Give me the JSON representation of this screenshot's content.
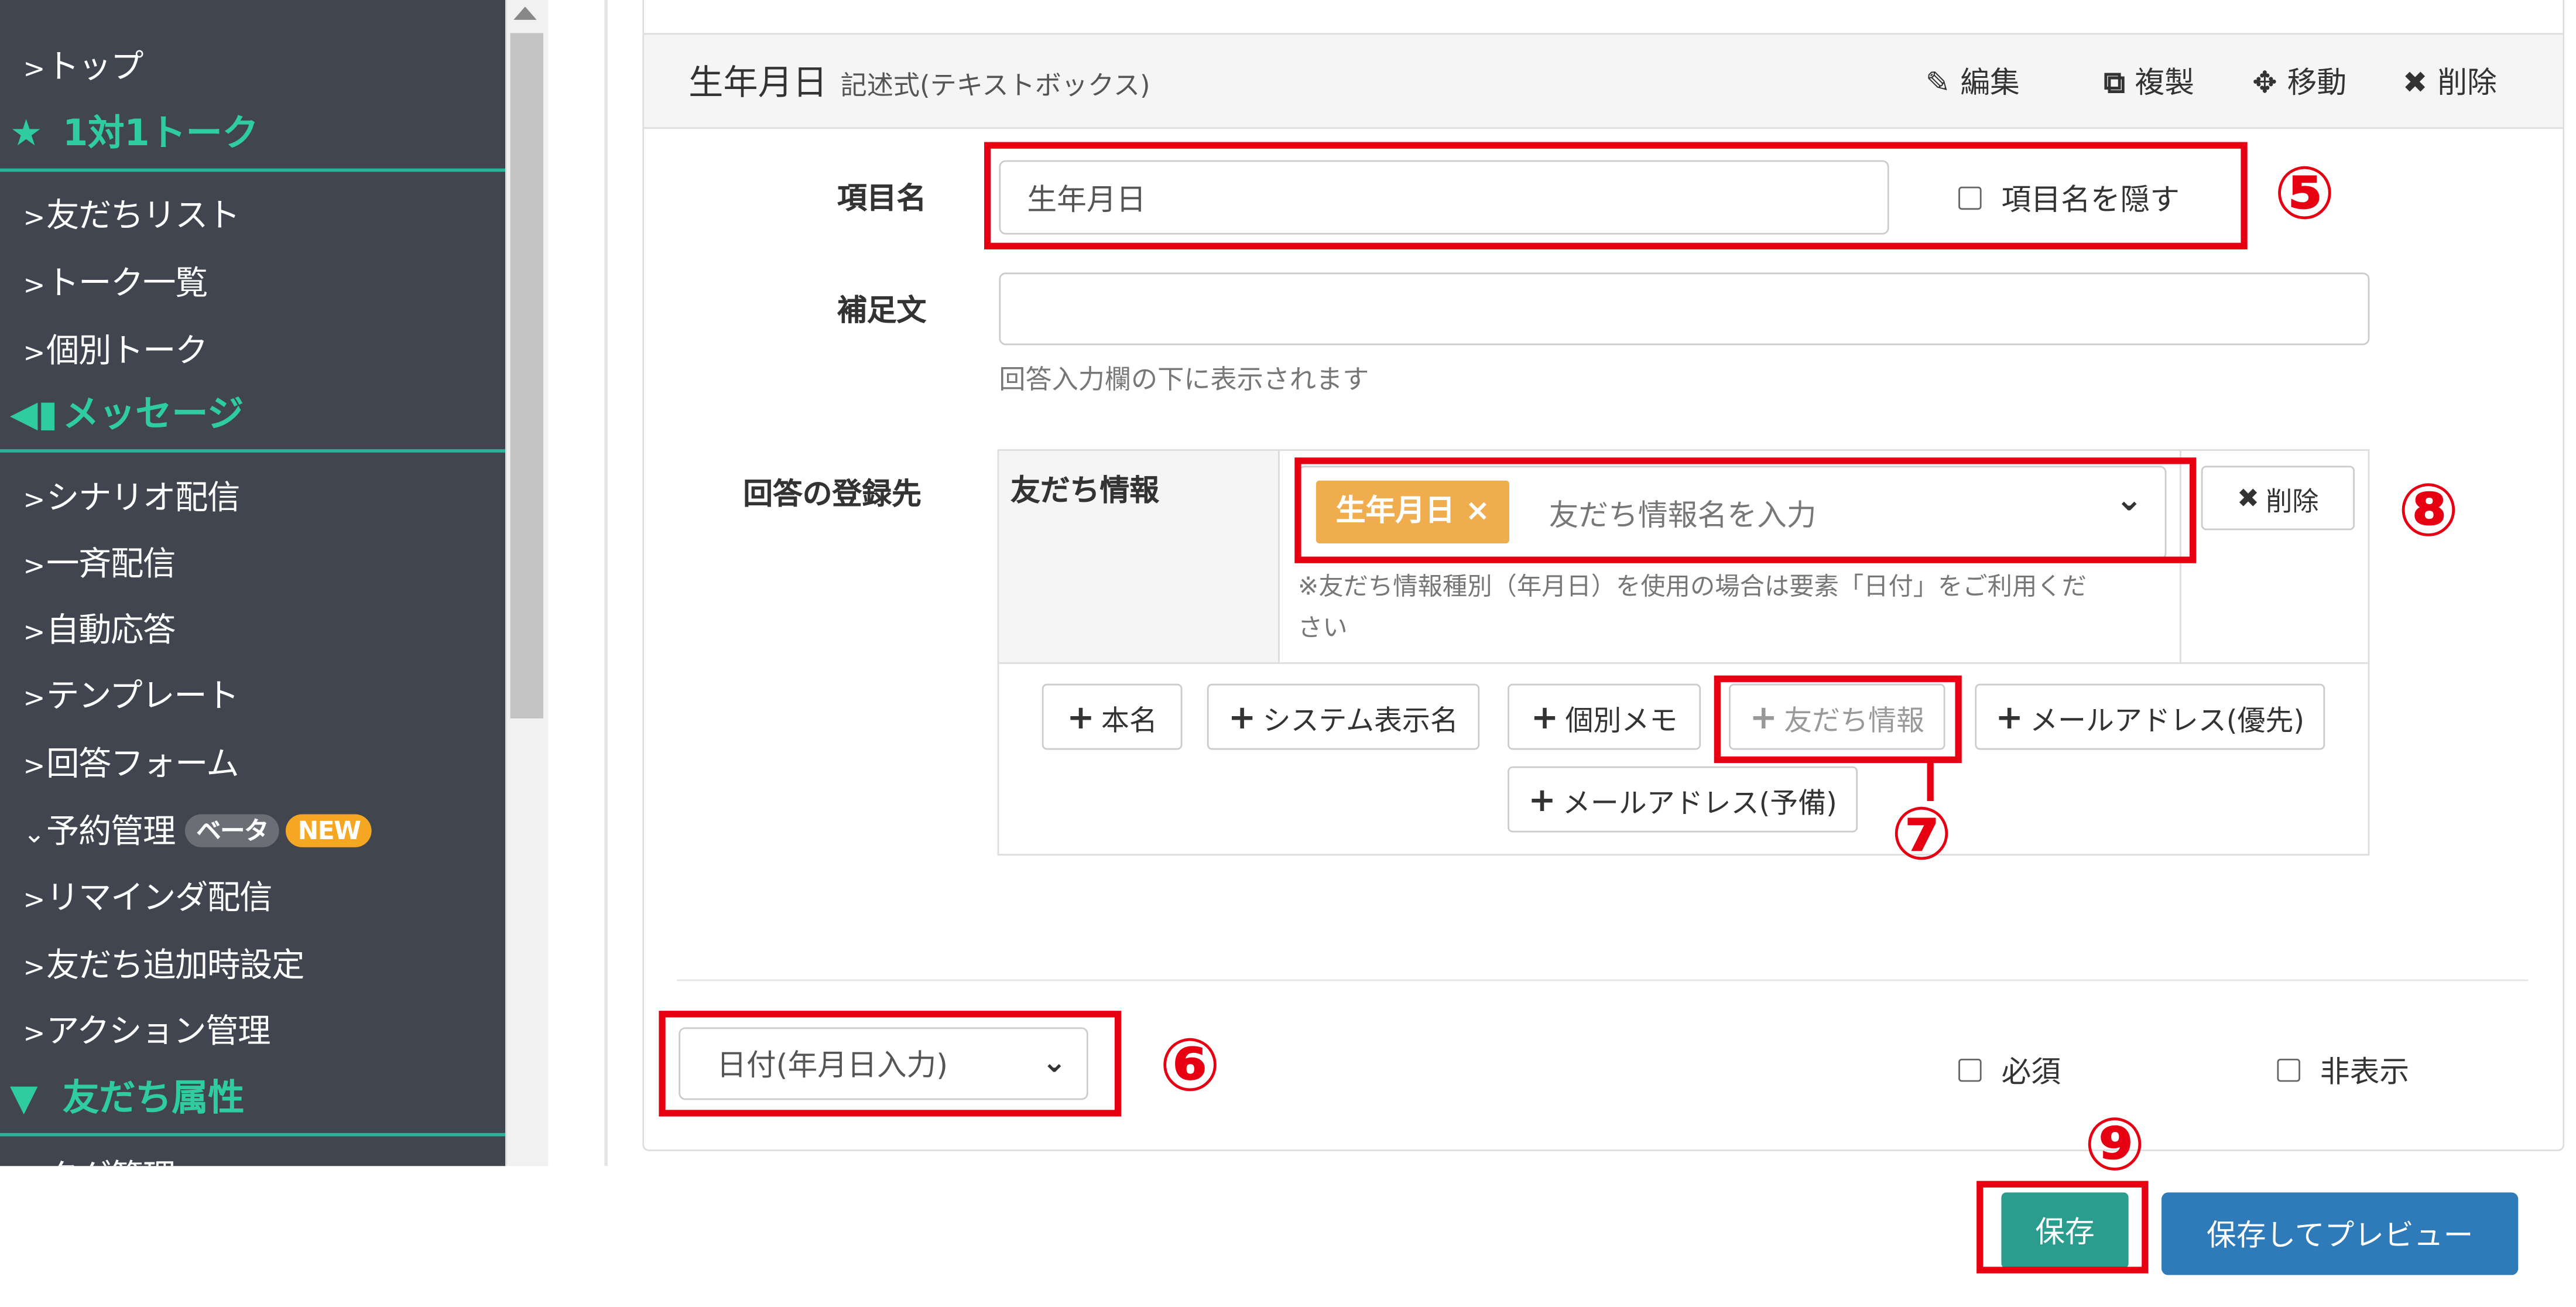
{
  "sidebar": {
    "items": [
      {
        "label": "トップ"
      },
      {
        "section": "1対1トーク"
      },
      {
        "label": "友だちリスト"
      },
      {
        "label": "トーク一覧"
      },
      {
        "label": "個別トーク"
      },
      {
        "section": "メッセージ"
      },
      {
        "label": "シナリオ配信"
      },
      {
        "label": "一斉配信"
      },
      {
        "label": "自動応答"
      },
      {
        "label": "テンプレート"
      },
      {
        "label": "回答フォーム"
      },
      {
        "label": "予約管理",
        "badge_beta": "ベータ",
        "badge_new": "NEW"
      },
      {
        "label": "リマインダ配信"
      },
      {
        "label": "友だち追加時設定"
      },
      {
        "label": "アクション管理"
      },
      {
        "section": "友だち属性"
      },
      {
        "label": "タグ管理"
      }
    ]
  },
  "card": {
    "title": "生年月日",
    "subtitle": "記述式(テキストボックス)",
    "tools": {
      "edit": "編集",
      "duplicate": "複製",
      "move": "移動",
      "delete": "削除"
    }
  },
  "form": {
    "item_name_label": "項目名",
    "item_name_value": "生年月日",
    "hide_name_label": "項目名を隠す",
    "supplement_label": "補足文",
    "supplement_value": "",
    "supplement_help": "回答入力欄の下に表示されます",
    "register_label": "回答の登録先",
    "friend_info_label": "友だち情報",
    "tag_value": "生年月日",
    "tag_remove": "×",
    "friend_info_placeholder": "友だち情報名を入力",
    "friend_info_note_1": "※友だち情報種別（年月日）を使用の場合は要素「日付」をご利用くだ",
    "friend_info_note_2": "さい",
    "row_delete": "削除",
    "add_buttons": {
      "real_name": "本名",
      "system_name": "システム表示名",
      "memo": "個別メモ",
      "friend_info": "友だち情報",
      "email_primary": "メールアドレス(優先)",
      "email_backup": "メールアドレス(予備)"
    },
    "type_select": "日付(年月日入力)",
    "required_label": "必須",
    "hidden_label": "非表示"
  },
  "actions": {
    "save": "保存",
    "save_preview": "保存してプレビュー"
  },
  "annotations": {
    "n5": "⑤",
    "n6": "⑥",
    "n7": "⑦",
    "n8": "⑧",
    "n9": "⑨"
  },
  "colors": {
    "sidebar_bg": "#41454f",
    "accent_green": "#2ecc9e",
    "annotation_red": "#e60012",
    "save_green": "#2a9d8f",
    "preview_blue": "#2f7ab8",
    "tag_orange": "#f0ad4e"
  }
}
